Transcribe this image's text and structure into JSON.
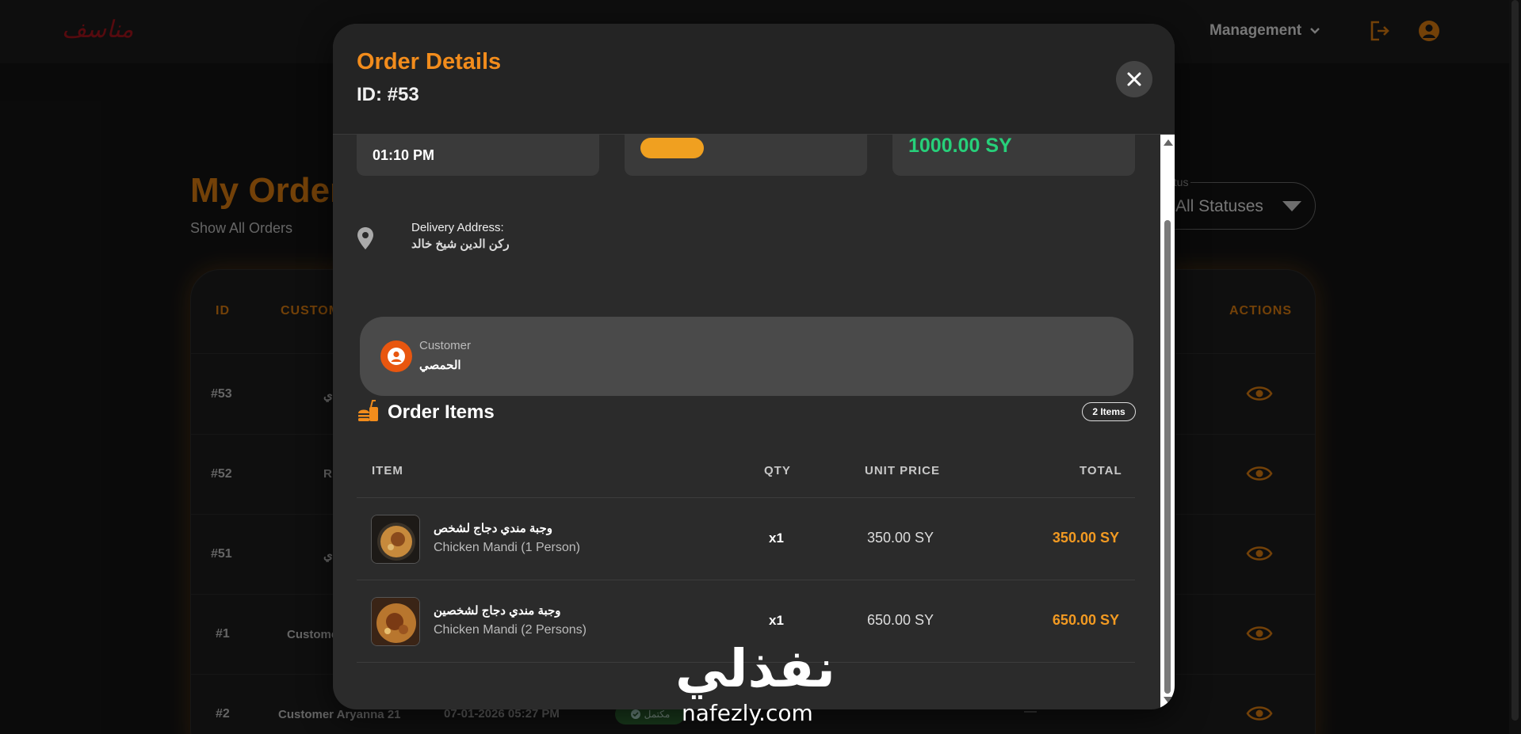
{
  "topbar": {
    "logo_text": "مناسف",
    "nav_partial": "s",
    "management_label": "Management",
    "icons": [
      "logout-icon",
      "user-circle-icon"
    ]
  },
  "orders_page": {
    "title": "My Order",
    "subtitle": "Show All Orders",
    "status_filter": {
      "label": "atus",
      "value": "All Statuses"
    },
    "columns": [
      "ID",
      "CUSTOM",
      "ACTIONS"
    ],
    "rows": [
      {
        "id": "#53",
        "customer": "ي"
      },
      {
        "id": "#52",
        "customer": "R"
      },
      {
        "id": "#51",
        "customer": "ي"
      },
      {
        "id": "#1",
        "customer": "Custome"
      },
      {
        "id": "#2",
        "customer": "Customer Aryanna 21",
        "date": "07-01-2026 05:27 PM",
        "status": "مكتمل",
        "note": "—"
      }
    ]
  },
  "modal": {
    "title": "Order Details",
    "id_label": "ID: #53",
    "info_time": "01:10 PM",
    "info_total": "1000.00 SY",
    "delivery_label": "Delivery Address:",
    "delivery_value": "ركن الدين شيخ خالد",
    "customer_label": "Customer",
    "customer_name": "الحمصي",
    "items_title": "Order Items",
    "items_count": "2 Items",
    "table_headers": {
      "item": "ITEM",
      "qty": "QTY",
      "unit_price": "UNIT PRICE",
      "total": "TOTAL"
    },
    "items": [
      {
        "name_ar": "وجبة مندي دجاج لشخص",
        "name_en": "Chicken Mandi (1 Person)",
        "qty": "x1",
        "unit_price": "350.00 SY",
        "total": "350.00 SY"
      },
      {
        "name_ar": "وجبة مندي دجاج لشخصين",
        "name_en": "Chicken Mandi (2 Persons)",
        "qty": "x1",
        "unit_price": "650.00 SY",
        "total": "650.00 SY"
      }
    ]
  },
  "watermark": {
    "arabic": "نفذلي",
    "latin": "nafezly.com"
  },
  "colors": {
    "accent": "#f28c1c",
    "total_green": "#27d07a",
    "avatar": "#e8560f",
    "background": "#141414"
  }
}
